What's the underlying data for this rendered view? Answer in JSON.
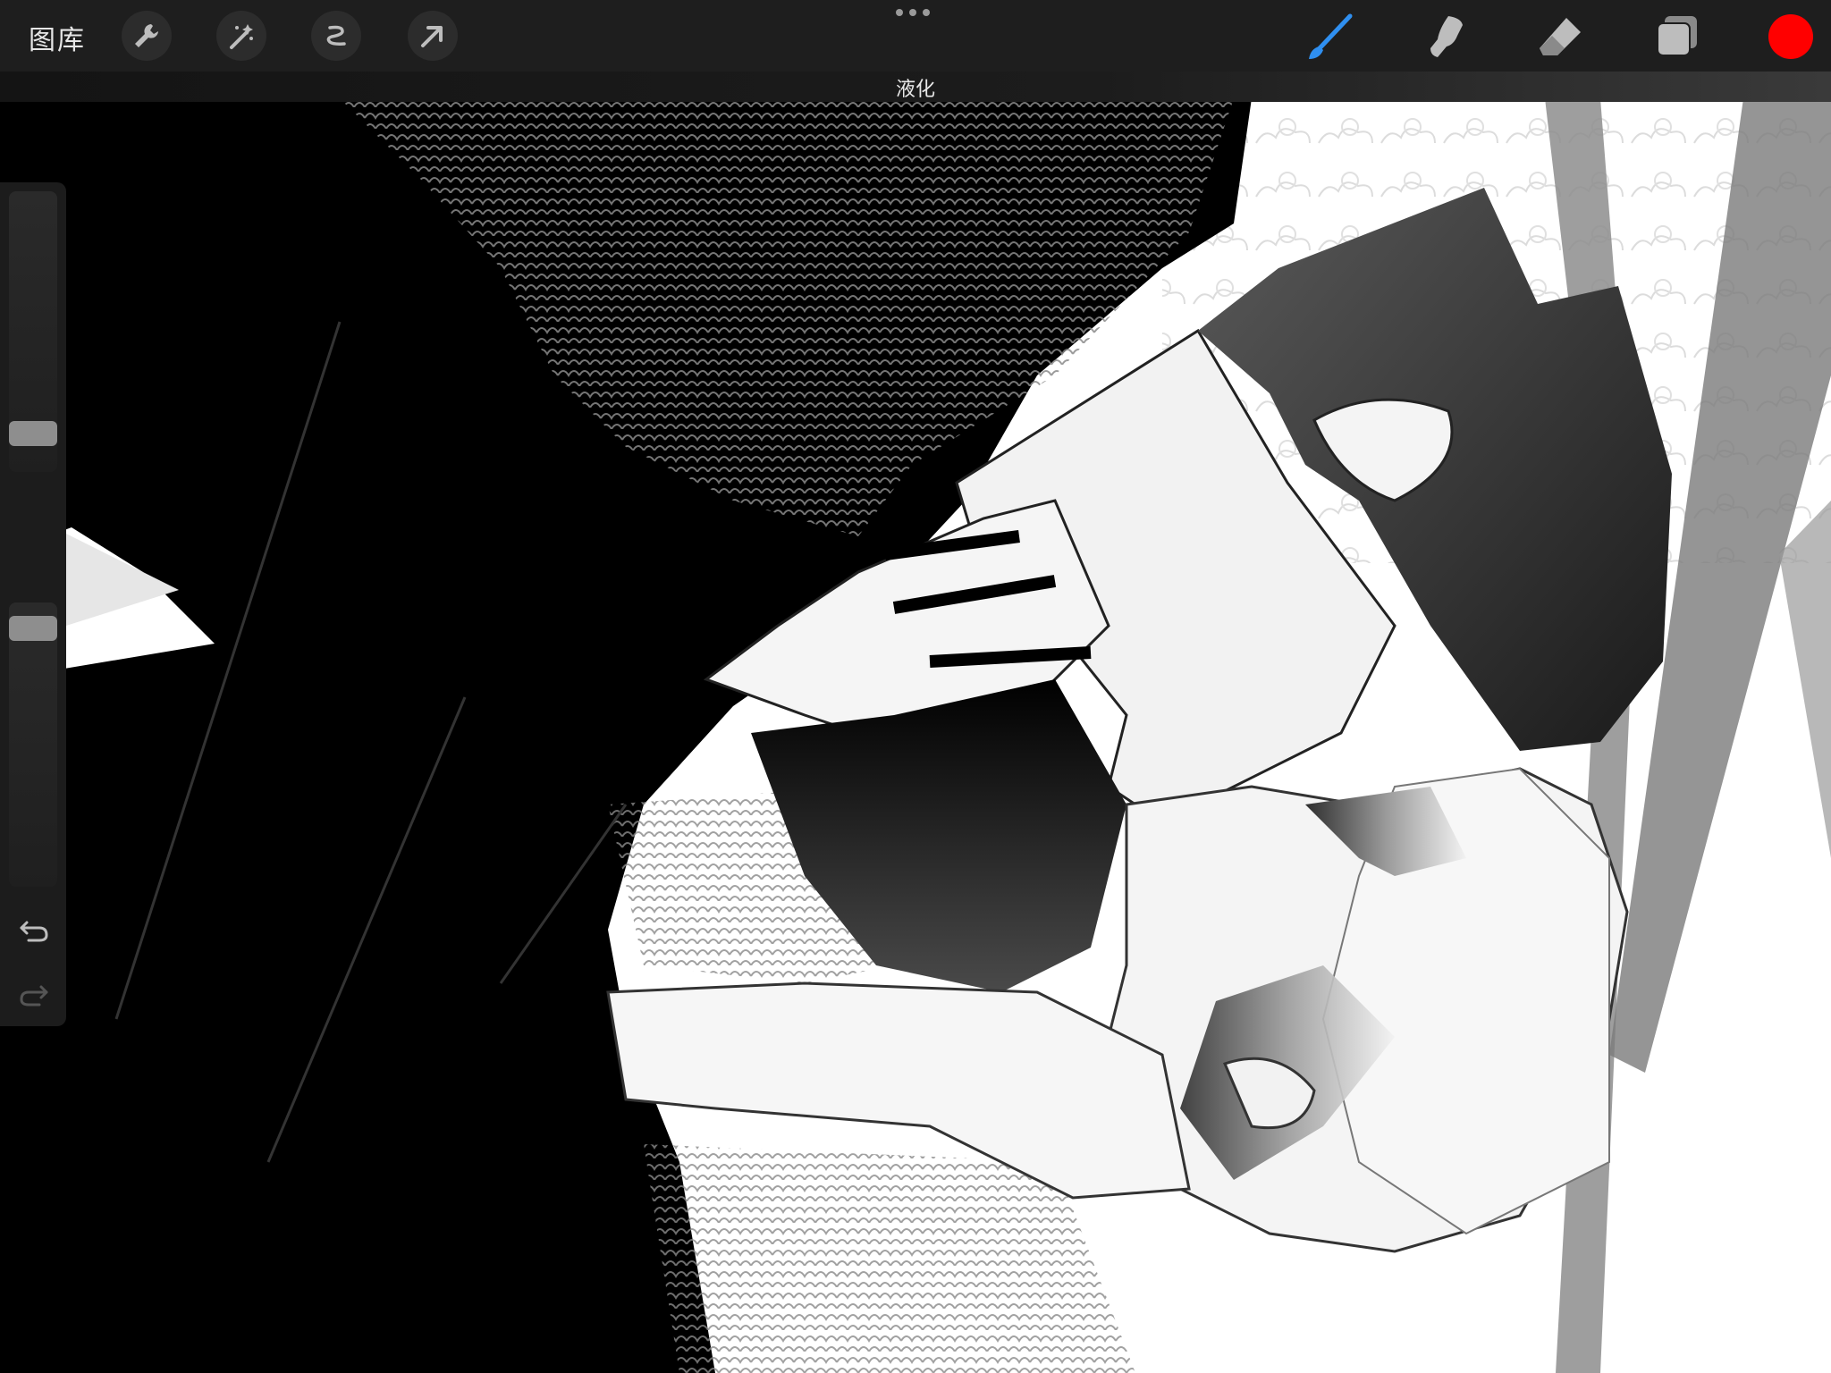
{
  "toolbar": {
    "gallery_label": "图库",
    "left_tools": [
      "wrench-icon",
      "magic-wand-icon",
      "selection-icon",
      "transform-arrow-icon"
    ],
    "right_tools": [
      "brush-icon",
      "smudge-icon",
      "eraser-icon",
      "layers-icon"
    ],
    "active_tool": "brush-icon",
    "active_tool_color": "#2f8ff0",
    "current_color": "#ff0000"
  },
  "status": {
    "label": "液化"
  },
  "sidebar": {
    "brush_size": 0.1,
    "opacity": 0.95,
    "undo_icon": "undo-icon",
    "redo_icon": "redo-icon"
  }
}
